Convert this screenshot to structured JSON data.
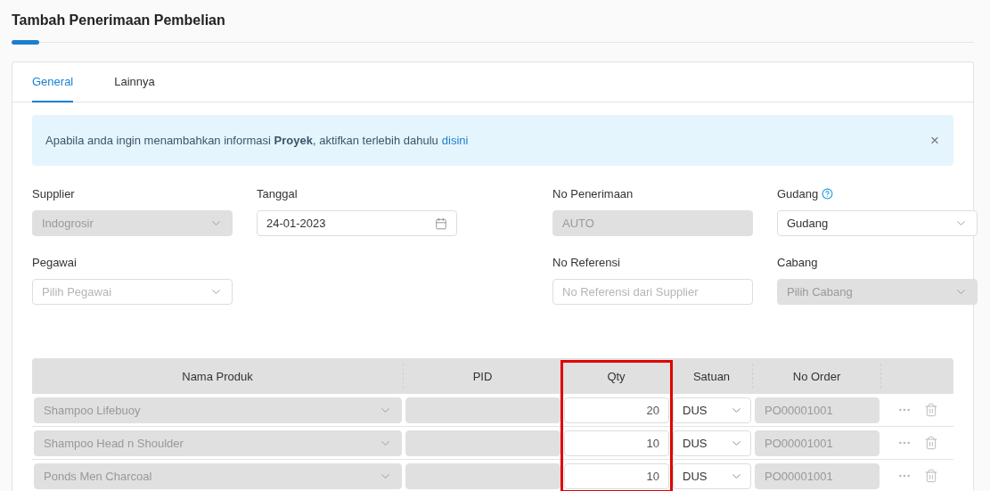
{
  "page": {
    "title": "Tambah Penerimaan Pembelian"
  },
  "tabs": [
    {
      "label": "General",
      "selected": true
    },
    {
      "label": "Lainnya",
      "selected": false
    }
  ],
  "alert": {
    "text": "Apabila anda ingin menambahkan informasi **Proyek**, aktifkan terlebih dahulu",
    "link": "disini",
    "close": "×"
  },
  "fields": [
    {
      "label": "Supplier",
      "kind": "select",
      "value": "Indogrosir",
      "disabled": true,
      "help": false
    },
    {
      "label": "Tanggal",
      "kind": "date",
      "value": "24-01-2023",
      "disabled": false,
      "help": false
    },
    {
      "kind": "spacer"
    },
    {
      "label": "No Penerimaan",
      "kind": "text",
      "value": "AUTO",
      "disabled": true,
      "help": false
    },
    {
      "label": "Gudang",
      "kind": "select",
      "value": "Gudang",
      "disabled": false,
      "help": true
    },
    {
      "label": "Pegawai",
      "kind": "select",
      "placeholder": "Pilih Pegawai",
      "disabled": false,
      "help": false
    },
    {
      "kind": "empty"
    },
    {
      "kind": "spacer"
    },
    {
      "label": "No Referensi",
      "kind": "text",
      "placeholder": "No Referensi dari Supplier",
      "disabled": false,
      "help": false
    },
    {
      "label": "Cabang",
      "kind": "select",
      "placeholder": "Pilih Cabang",
      "disabled": true,
      "help": false
    }
  ],
  "table": {
    "columns": [
      {
        "label": "Nama Produk",
        "highlighted": false
      },
      {
        "label": "PID",
        "highlighted": false
      },
      {
        "label": "Qty",
        "highlighted": true
      },
      {
        "label": "Satuan",
        "highlighted": false
      },
      {
        "label": "No Order",
        "highlighted": false
      }
    ],
    "rows": [
      {
        "product": "Shampoo Lifebuoy",
        "qty": "20",
        "unit": "DUS",
        "order": "PO00001001"
      },
      {
        "product": "Shampoo Head n Shoulder",
        "qty": "10",
        "unit": "DUS",
        "order": "PO00001001"
      },
      {
        "product": "Ponds Men Charcoal",
        "qty": "10",
        "unit": "DUS",
        "order": "PO00001001"
      }
    ]
  }
}
